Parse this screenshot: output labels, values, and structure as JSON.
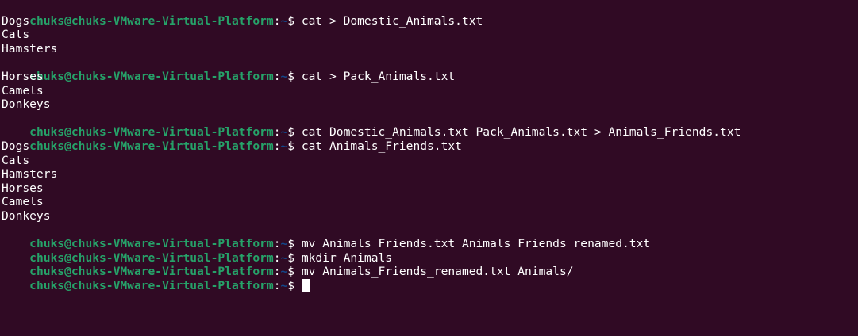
{
  "terminal": {
    "background": "#300a24",
    "colors": {
      "user_host": "#26a269",
      "path": "#12488b",
      "text": "#ffffff"
    },
    "prompt": {
      "user_host": "chuks@chuks-VMware-Virtual-Platform",
      "colon": ":",
      "path": "~",
      "symbol": "$ "
    },
    "lines": [
      {
        "type": "cmd",
        "text": "cat > Domestic_Animals.txt"
      },
      {
        "type": "out",
        "text": "Dogs"
      },
      {
        "type": "out",
        "text": "Cats"
      },
      {
        "type": "out",
        "text": "Hamsters"
      },
      {
        "type": "cmd",
        "text": "cat > Pack_Animals.txt"
      },
      {
        "type": "out",
        "text": "Horses"
      },
      {
        "type": "out",
        "text": "Camels"
      },
      {
        "type": "out",
        "text": "Donkeys"
      },
      {
        "type": "cmd",
        "text": "cat Domestic_Animals.txt Pack_Animals.txt > Animals_Friends.txt"
      },
      {
        "type": "cmd",
        "text": "cat Animals_Friends.txt"
      },
      {
        "type": "out",
        "text": "Dogs"
      },
      {
        "type": "out",
        "text": "Cats"
      },
      {
        "type": "out",
        "text": "Hamsters"
      },
      {
        "type": "out",
        "text": "Horses"
      },
      {
        "type": "out",
        "text": "Camels"
      },
      {
        "type": "out",
        "text": "Donkeys"
      },
      {
        "type": "cmd",
        "text": "mv Animals_Friends.txt Animals_Friends_renamed.txt"
      },
      {
        "type": "cmd",
        "text": "mkdir Animals"
      },
      {
        "type": "cmd",
        "text": "mv Animals_Friends_renamed.txt Animals/"
      },
      {
        "type": "active",
        "text": ""
      }
    ]
  }
}
